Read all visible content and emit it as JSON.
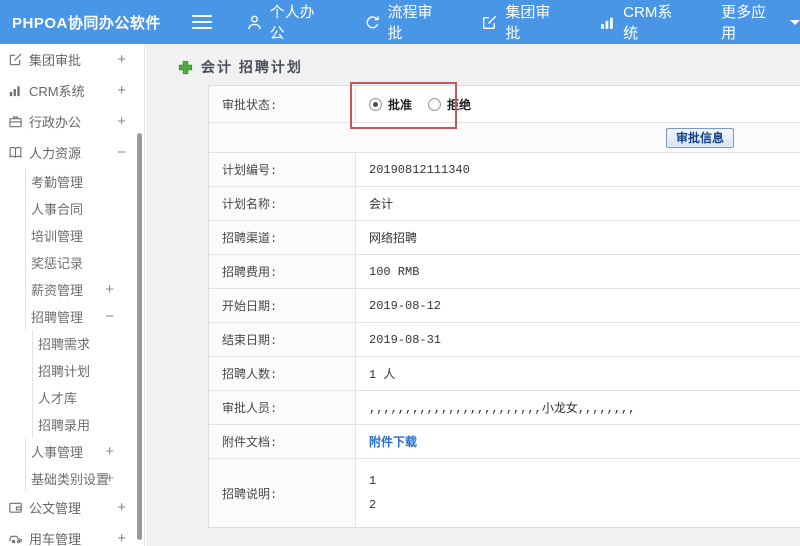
{
  "colors": {
    "header_blue": "#4a96e6",
    "link_blue": "#2a6fc9",
    "annotation_red": "#c05a5a",
    "plus_green": "#4caf3f",
    "button_text_blue": "#16408c"
  },
  "header": {
    "logo": "PHPOA协同办公软件",
    "nav": [
      {
        "label": "个人办公",
        "icon": "user-icon"
      },
      {
        "label": "流程审批",
        "icon": "cycle-icon"
      },
      {
        "label": "集团审批",
        "icon": "edit-icon"
      },
      {
        "label": "CRM系统",
        "icon": "chart-icon"
      },
      {
        "label": "更多应用",
        "icon": "caret-down-icon"
      }
    ]
  },
  "sidebar": {
    "items": [
      {
        "label": "集团审批",
        "icon": "edit-icon",
        "toggle": "+",
        "level": 1
      },
      {
        "label": "CRM系统",
        "icon": "chart-icon",
        "toggle": "+",
        "level": 1
      },
      {
        "label": "行政办公",
        "icon": "briefcase-icon",
        "toggle": "+",
        "level": 1
      },
      {
        "label": "人力资源",
        "icon": "book-icon",
        "toggle": "−",
        "level": 1
      },
      {
        "label": "考勤管理",
        "level": 2
      },
      {
        "label": "人事合同",
        "level": 2
      },
      {
        "label": "培训管理",
        "level": 2
      },
      {
        "label": "奖惩记录",
        "level": 2
      },
      {
        "label": "薪资管理",
        "toggle": "+",
        "level": 2
      },
      {
        "label": "招聘管理",
        "toggle": "−",
        "level": 2
      },
      {
        "label": "招聘需求",
        "level": 3
      },
      {
        "label": "招聘计划",
        "level": 3
      },
      {
        "label": "人才库",
        "level": 3
      },
      {
        "label": "招聘录用",
        "level": 3
      },
      {
        "label": "人事管理",
        "toggle": "+",
        "level": 2
      },
      {
        "label": "基础类别设置",
        "toggle": "+",
        "level": 2
      },
      {
        "label": "公文管理",
        "icon": "document-icon",
        "toggle": "+",
        "level": 1
      },
      {
        "label": "用车管理",
        "icon": "car-icon",
        "toggle": "+",
        "level": 1
      }
    ]
  },
  "main": {
    "title": "会计 招聘计划",
    "approval": {
      "status_label": "审批状态:",
      "options": [
        {
          "label": "批准",
          "selected": true
        },
        {
          "label": "拒绝",
          "selected": false
        }
      ],
      "info_button": "审批信息"
    },
    "fields": [
      {
        "label": "计划编号:",
        "value": "20190812111340"
      },
      {
        "label": "计划名称:",
        "value": "会计"
      },
      {
        "label": "招聘渠道:",
        "value": "网络招聘"
      },
      {
        "label": "招聘费用:",
        "value": "100 RMB"
      },
      {
        "label": "开始日期:",
        "value": "2019-08-12"
      },
      {
        "label": "结束日期:",
        "value": "2019-08-31"
      },
      {
        "label": "招聘人数:",
        "value": "1 人"
      },
      {
        "label": "审批人员:",
        "value": ",,,,,,,,,,,,,,,,,,,,,,,,小龙女,,,,,,,,"
      }
    ],
    "attachment": {
      "label": "附件文档:",
      "link": "附件下载"
    },
    "description": {
      "label": "招聘说明:",
      "lines": [
        "1",
        "2"
      ]
    }
  }
}
